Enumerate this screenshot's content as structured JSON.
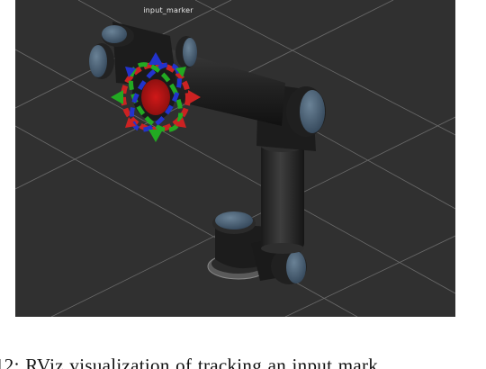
{
  "viewport": {
    "marker_label": "input_marker",
    "background_color": "#303030",
    "grid_color": "#a0a0a0",
    "robot_color": "#1e1e1e",
    "joint_cap_color": "#4c6276",
    "marker_ring_x_color": "#cc2222",
    "marker_ring_y_color": "#22aa22",
    "marker_ring_z_color": "#2233cc"
  },
  "caption": {
    "text": "12: RViz visualization of tracking an input mark"
  }
}
